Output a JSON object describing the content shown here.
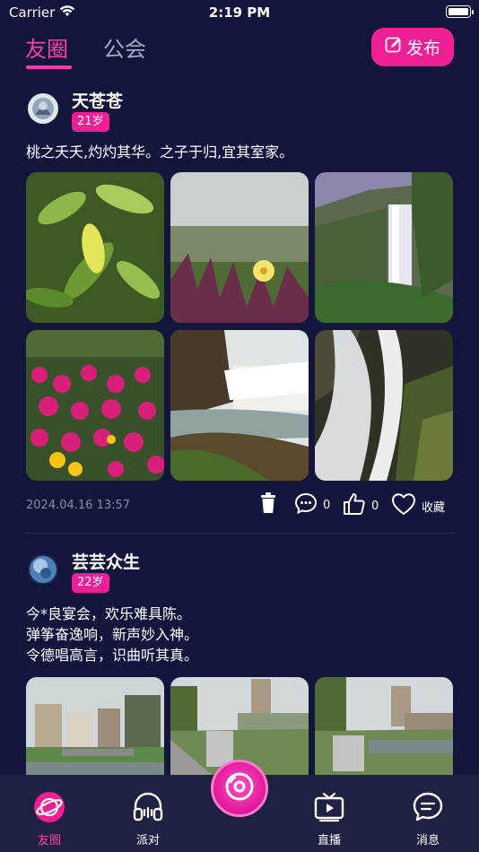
{
  "status_bar": {
    "carrier": "Carrier",
    "time": "2:19 PM"
  },
  "header": {
    "tabs": [
      {
        "label": "友圈",
        "active": true
      },
      {
        "label": "公会",
        "active": false
      }
    ],
    "publish_label": "发布"
  },
  "posts": [
    {
      "username": "天苍苍",
      "age": "21岁",
      "text_lines": [
        "桃之夭夭,灼灼其华。之子于归,宜其室家。"
      ],
      "photo_count": 6,
      "date": "2024.04.16 13:57",
      "comment_count": "0",
      "like_count": "0",
      "favorite_label": "收藏"
    },
    {
      "username": "芸芸众生",
      "age": "22岁",
      "text_lines": [
        "今*良宴会，欢乐难具陈。",
        "弹筝奋逸响，新声妙入神。",
        "令德唱高言，识曲听其真。"
      ],
      "photo_count": 3
    }
  ],
  "tabbar": {
    "items": [
      {
        "label": "友圈",
        "icon": "planet-icon",
        "active": true
      },
      {
        "label": "派对",
        "icon": "headphones-icon",
        "active": false
      },
      {
        "label": "",
        "icon": "record-icon",
        "active": false
      },
      {
        "label": "直播",
        "icon": "tv-icon",
        "active": false
      },
      {
        "label": "消息",
        "icon": "chat-icon",
        "active": false
      }
    ]
  },
  "colors": {
    "background": "#13153d",
    "accent": "#f01f96",
    "tabbar": "#1f2143",
    "muted": "#8a8ca8"
  }
}
